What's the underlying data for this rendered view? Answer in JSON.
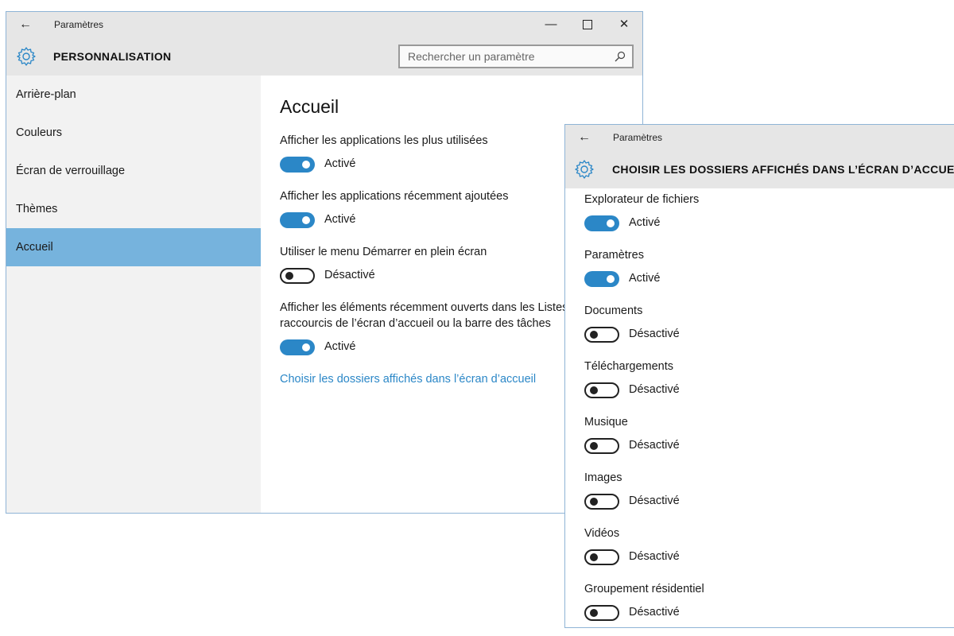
{
  "window1": {
    "app_title": "Paramètres",
    "header_title": "PERSONNALISATION",
    "search_placeholder": "Rechercher un paramètre",
    "sidebar": {
      "items": [
        {
          "label": "Arrière-plan"
        },
        {
          "label": "Couleurs"
        },
        {
          "label": "Écran de verrouillage"
        },
        {
          "label": "Thèmes"
        },
        {
          "label": "Accueil",
          "selected": true
        }
      ]
    },
    "page_title": "Accueil",
    "settings": [
      {
        "label": "Afficher les applications les plus utilisées",
        "state": "Activé",
        "on": true
      },
      {
        "label": "Afficher les applications récemment ajoutées",
        "state": "Activé",
        "on": true
      },
      {
        "label": "Utiliser le menu Démarrer en plein écran",
        "state": "Désactivé",
        "on": false
      },
      {
        "label": "Afficher les éléments récemment ouverts dans les Listes de raccourcis de l’écran d’accueil ou la barre des tâches",
        "label_line1": "Afficher les éléments récemment ouverts dans les Listes de",
        "label_line2": "raccourcis de l’écran d’accueil ou la barre des tâches",
        "state": "Activé",
        "on": true
      }
    ],
    "link": "Choisir les dossiers affichés dans l’écran d’accueil"
  },
  "window2": {
    "app_title": "Paramètres",
    "header_title": "CHOISIR LES DOSSIERS AFFICHÉS DANS L’ÉCRAN D’ACCUEIL",
    "folders": [
      {
        "label": "Explorateur de fichiers",
        "state": "Activé",
        "on": true
      },
      {
        "label": "Paramètres",
        "state": "Activé",
        "on": true
      },
      {
        "label": "Documents",
        "state": "Désactivé",
        "on": false
      },
      {
        "label": "Téléchargements",
        "state": "Désactivé",
        "on": false
      },
      {
        "label": "Musique",
        "state": "Désactivé",
        "on": false
      },
      {
        "label": "Images",
        "state": "Désactivé",
        "on": false
      },
      {
        "label": "Vidéos",
        "state": "Désactivé",
        "on": false
      },
      {
        "label": "Groupement résidentiel",
        "state": "Désactivé",
        "on": false
      }
    ]
  },
  "icons": {
    "back": "back-arrow-icon",
    "gear": "gear-icon",
    "search": "search-icon",
    "minimize": "minimize-icon",
    "maximize": "maximize-icon",
    "close": "close-icon"
  },
  "colors": {
    "accent": "#2b87c7",
    "selected_nav": "#76b3dd",
    "chrome": "#e6e6e6",
    "sidebar": "#f2f2f2"
  }
}
